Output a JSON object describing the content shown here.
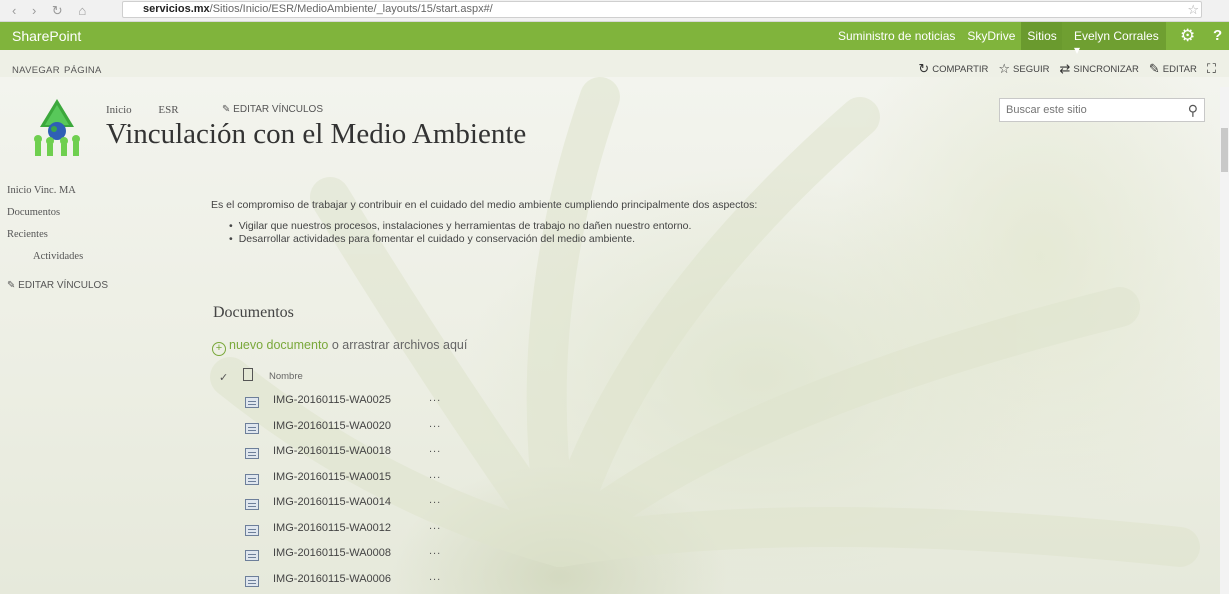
{
  "browser": {
    "nav_glyphs": "‹ › ↻ ⌂",
    "url_domain": "servicios.mx",
    "url_path": "/Sitios/Inicio/ESR/MedioAmbiente/_layouts/15/start.aspx#/"
  },
  "suite_bar": {
    "brand": "SharePoint",
    "links": [
      "Suministro de noticias",
      "SkyDrive",
      "Sitios"
    ],
    "user": "Evelyn Corrales ▾",
    "colors": {
      "bar": "#80b43c",
      "active": "#6a9a2e"
    }
  },
  "ribbon": {
    "tabs": [
      "NAVEGAR",
      "PÁGINA"
    ],
    "actions": [
      "COMPARTIR",
      "SEGUIR",
      "SINCRONIZAR",
      "EDITAR"
    ]
  },
  "header": {
    "breadcrumb": [
      "Inicio",
      "ESR"
    ],
    "edit_links": "EDITAR VÍNCULOS",
    "title": "Vinculación con el Medio Ambiente",
    "search_placeholder": "Buscar este sitio"
  },
  "left_nav": {
    "items": [
      {
        "label": "Inicio Vinc. MA",
        "sub": false
      },
      {
        "label": "Documentos",
        "sub": false
      },
      {
        "label": "Recientes",
        "sub": false
      },
      {
        "label": "Actividades",
        "sub": true
      }
    ],
    "edit_links": "EDITAR VÍNCULOS"
  },
  "main": {
    "intro": "Es el compromiso de trabajar y contribuir en el cuidado del medio ambiente cumpliendo principalmente dos aspectos:",
    "bullets": [
      "Vigilar que nuestros procesos, instalaciones y herramientas de trabajo no dañen nuestro entorno.",
      "Desarrollar actividades para fomentar el cuidado y conservación del medio ambiente."
    ]
  },
  "documents": {
    "title": "Documentos",
    "new_link": "nuevo documento",
    "new_suffix": " o arrastrar archivos aquí",
    "column_name": "Nombre",
    "files": [
      "IMG-20160115-WA0025",
      "IMG-20160115-WA0020",
      "IMG-20160115-WA0018",
      "IMG-20160115-WA0015",
      "IMG-20160115-WA0014",
      "IMG-20160115-WA0012",
      "IMG-20160115-WA0008",
      "IMG-20160115-WA0006"
    ],
    "ellipsis": "..."
  }
}
